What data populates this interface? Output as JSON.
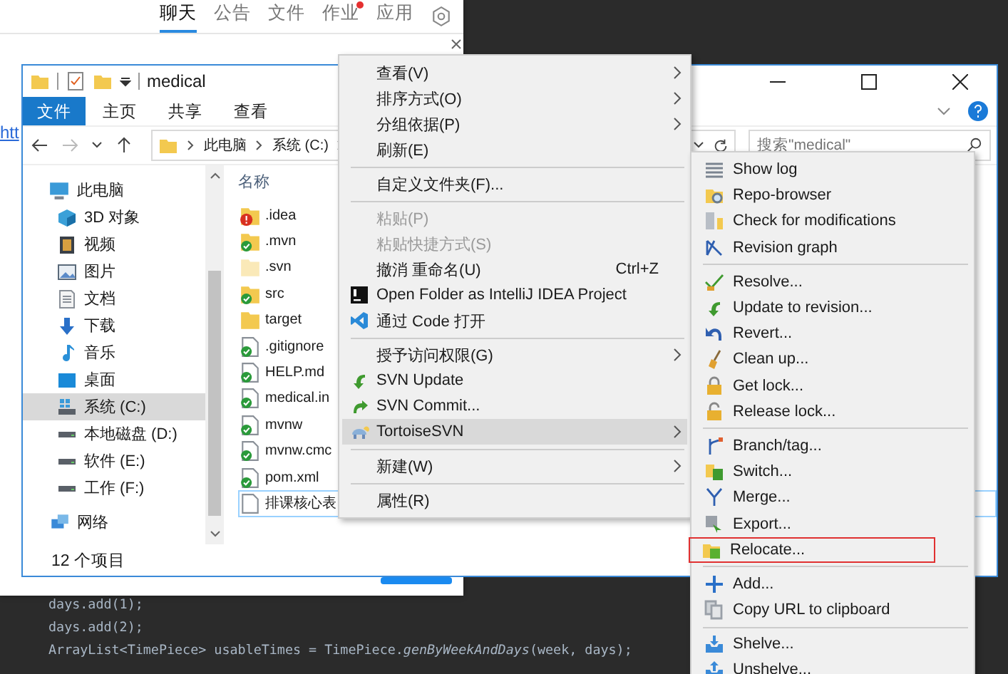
{
  "chat_window": {
    "tabs": [
      {
        "label": "聊天",
        "selected": true,
        "dot": false
      },
      {
        "label": "公告",
        "selected": false,
        "dot": false
      },
      {
        "label": "文件",
        "selected": false,
        "dot": false
      },
      {
        "label": "作业",
        "selected": false,
        "dot": true
      },
      {
        "label": "应用",
        "selected": false,
        "dot": false
      }
    ],
    "link_fragment": "htt"
  },
  "explorer": {
    "title": "medical",
    "ribbon_tabs": [
      {
        "label": "文件",
        "selected": true
      },
      {
        "label": "主页",
        "selected": false
      },
      {
        "label": "共享",
        "selected": false
      },
      {
        "label": "查看",
        "selected": false
      }
    ],
    "breadcrumb": [
      "此电脑",
      "系统 (C:)"
    ],
    "search": {
      "placeholder": "搜索\"medical\""
    },
    "nav": [
      {
        "label": "此电脑",
        "selected": false,
        "children": [
          {
            "label": "3D 对象",
            "selected": false
          },
          {
            "label": "视频",
            "selected": false
          },
          {
            "label": "图片",
            "selected": false
          },
          {
            "label": "文档",
            "selected": false
          },
          {
            "label": "下载",
            "selected": false
          },
          {
            "label": "音乐",
            "selected": false
          },
          {
            "label": "桌面",
            "selected": false
          },
          {
            "label": "系统 (C:)",
            "selected": true
          },
          {
            "label": "本地磁盘 (D:)",
            "selected": false
          },
          {
            "label": "软件 (E:)",
            "selected": false
          },
          {
            "label": "工作 (F:)",
            "selected": false
          }
        ]
      },
      {
        "label": "网络",
        "selected": false
      }
    ],
    "column_header": "名称",
    "files": [
      {
        "name": ".idea",
        "kind": "folder",
        "svn_ok": false,
        "svn_conflict": true,
        "hidden": false,
        "focused": false
      },
      {
        "name": ".mvn",
        "kind": "folder",
        "svn_ok": true,
        "svn_conflict": false,
        "hidden": false,
        "focused": false
      },
      {
        "name": ".svn",
        "kind": "folder",
        "svn_ok": false,
        "svn_conflict": false,
        "hidden": true,
        "focused": false
      },
      {
        "name": "src",
        "kind": "folder",
        "svn_ok": true,
        "svn_conflict": false,
        "hidden": false,
        "focused": false
      },
      {
        "name": "target",
        "kind": "folder",
        "svn_ok": false,
        "svn_conflict": false,
        "hidden": false,
        "focused": false
      },
      {
        "name": ".gitignore",
        "kind": "file",
        "svn_ok": true,
        "svn_conflict": false,
        "hidden": false,
        "focused": false
      },
      {
        "name": "HELP.md",
        "kind": "file",
        "svn_ok": true,
        "svn_conflict": false,
        "hidden": false,
        "focused": false
      },
      {
        "name": "medical.in",
        "kind": "file",
        "svn_ok": true,
        "svn_conflict": false,
        "hidden": false,
        "focused": false
      },
      {
        "name": "mvnw",
        "kind": "file",
        "svn_ok": true,
        "svn_conflict": false,
        "hidden": false,
        "focused": false
      },
      {
        "name": "mvnw.cmc",
        "kind": "file",
        "svn_ok": true,
        "svn_conflict": false,
        "hidden": false,
        "focused": false
      },
      {
        "name": "pom.xml",
        "kind": "file",
        "svn_ok": true,
        "svn_conflict": false,
        "hidden": false,
        "focused": false
      },
      {
        "name": "排课核心表",
        "kind": "file",
        "svn_ok": false,
        "svn_conflict": false,
        "hidden": false,
        "focused": true
      }
    ],
    "status": "12 个项目"
  },
  "context_menu": {
    "items": [
      {
        "kind": "item",
        "label": "查看(V)",
        "submenu": true,
        "disabled": false,
        "selected": false
      },
      {
        "kind": "item",
        "label": "排序方式(O)",
        "submenu": true,
        "disabled": false,
        "selected": false
      },
      {
        "kind": "item",
        "label": "分组依据(P)",
        "submenu": true,
        "disabled": false,
        "selected": false
      },
      {
        "kind": "item",
        "label": "刷新(E)",
        "submenu": false,
        "disabled": false,
        "selected": false
      },
      {
        "kind": "separator"
      },
      {
        "kind": "item",
        "label": "自定义文件夹(F)...",
        "submenu": false,
        "disabled": false,
        "selected": false
      },
      {
        "kind": "separator"
      },
      {
        "kind": "item",
        "label": "粘贴(P)",
        "submenu": false,
        "disabled": true,
        "selected": false
      },
      {
        "kind": "item",
        "label": "粘贴快捷方式(S)",
        "submenu": false,
        "disabled": true,
        "selected": false
      },
      {
        "kind": "item",
        "label": "撤消 重命名(U)",
        "shortcut": "Ctrl+Z",
        "submenu": false,
        "disabled": false,
        "selected": false
      },
      {
        "kind": "item",
        "label": "Open Folder as IntelliJ IDEA Project",
        "submenu": false,
        "disabled": false,
        "selected": false
      },
      {
        "kind": "item",
        "label": "通过 Code 打开",
        "submenu": false,
        "disabled": false,
        "selected": false
      },
      {
        "kind": "separator"
      },
      {
        "kind": "item",
        "label": "授予访问权限(G)",
        "submenu": true,
        "disabled": false,
        "selected": false
      },
      {
        "kind": "item",
        "label": "SVN Update",
        "submenu": false,
        "disabled": false,
        "selected": false
      },
      {
        "kind": "item",
        "label": "SVN Commit...",
        "submenu": false,
        "disabled": false,
        "selected": false
      },
      {
        "kind": "item",
        "label": "TortoiseSVN",
        "submenu": true,
        "disabled": false,
        "selected": true
      },
      {
        "kind": "separator"
      },
      {
        "kind": "item",
        "label": "新建(W)",
        "submenu": true,
        "disabled": false,
        "selected": false
      },
      {
        "kind": "separator"
      },
      {
        "kind": "item",
        "label": "属性(R)",
        "submenu": false,
        "disabled": false,
        "selected": false
      }
    ]
  },
  "tortoise_menu": {
    "items": [
      {
        "kind": "item",
        "label": "Show log",
        "highlighted": false
      },
      {
        "kind": "item",
        "label": "Repo-browser",
        "highlighted": false
      },
      {
        "kind": "item",
        "label": "Check for modifications",
        "highlighted": false
      },
      {
        "kind": "item",
        "label": "Revision graph",
        "highlighted": false
      },
      {
        "kind": "separator"
      },
      {
        "kind": "item",
        "label": "Resolve...",
        "highlighted": false
      },
      {
        "kind": "item",
        "label": "Update to revision...",
        "highlighted": false
      },
      {
        "kind": "item",
        "label": "Revert...",
        "highlighted": false
      },
      {
        "kind": "item",
        "label": "Clean up...",
        "highlighted": false
      },
      {
        "kind": "item",
        "label": "Get lock...",
        "highlighted": false
      },
      {
        "kind": "item",
        "label": "Release lock...",
        "highlighted": false
      },
      {
        "kind": "separator"
      },
      {
        "kind": "item",
        "label": "Branch/tag...",
        "highlighted": false
      },
      {
        "kind": "item",
        "label": "Switch...",
        "highlighted": false
      },
      {
        "kind": "item",
        "label": "Merge...",
        "highlighted": false
      },
      {
        "kind": "item",
        "label": "Export...",
        "highlighted": false
      },
      {
        "kind": "item",
        "label": "Relocate...",
        "highlighted": true
      },
      {
        "kind": "separator"
      },
      {
        "kind": "item",
        "label": "Add...",
        "highlighted": false
      },
      {
        "kind": "item",
        "label": "Copy URL to clipboard",
        "highlighted": false
      },
      {
        "kind": "separator"
      },
      {
        "kind": "item",
        "label": "Shelve...",
        "highlighted": false
      },
      {
        "kind": "item",
        "label": "Unshelve...",
        "highlighted": false
      }
    ]
  },
  "code_lines": [
    "days.add(1);",
    "days.add(2);",
    "ArrayList<TimePiece> usableTimes = TimePiece.*genByWeekAndDays*(week, days);"
  ]
}
